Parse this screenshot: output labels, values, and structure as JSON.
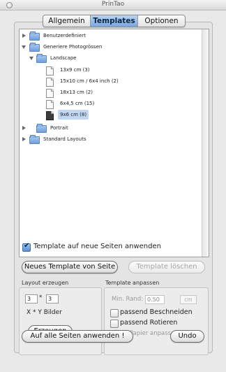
{
  "window": {
    "title": "PrinTao"
  },
  "tabs": [
    {
      "label": "Allgemein",
      "active": false
    },
    {
      "label": "Templates",
      "active": true
    },
    {
      "label": "Optionen",
      "active": false
    }
  ],
  "tree": {
    "items": [
      {
        "label": "Benutzerdefiniert",
        "type": "folder",
        "expanded": false
      },
      {
        "label": "Generiere Photogrössen",
        "type": "folder",
        "expanded": true
      },
      {
        "label": "Landscape",
        "type": "folder",
        "expanded": true
      },
      {
        "label": "13x9 cm (3)",
        "type": "template"
      },
      {
        "label": "15x10 cm / 6x4 inch (2)",
        "type": "template"
      },
      {
        "label": "18x13 cm (2)",
        "type": "template"
      },
      {
        "label": "6x4,5 cm (15)",
        "type": "template"
      },
      {
        "label": "9x6 cm (8)",
        "type": "template",
        "selected": true
      },
      {
        "label": "Portrait",
        "type": "folder",
        "expanded": false
      },
      {
        "label": "Standard Layouts",
        "type": "folder",
        "expanded": false
      }
    ]
  },
  "apply_new_pages": {
    "label": "Template auf neue Seiten anwenden",
    "checked": true
  },
  "buttons": {
    "new_template": "Neues Template von Seite",
    "delete_template": "Template löschen",
    "create": "Erzeugen",
    "apply_all": "Auf alle Seiten anwenden !",
    "undo": "Undo"
  },
  "layout_group": {
    "title": "Layout erzeugen",
    "x_value": "3",
    "y_value": "3",
    "multiply": "*",
    "caption": "X * Y Bilder"
  },
  "template_group": {
    "title": "Template anpassen",
    "min_rand_label": "Min. Rand:",
    "min_rand_value": "0.50",
    "unit": "cm",
    "fit_crop": {
      "label": "passend Beschneiden",
      "checked": false
    },
    "fit_rotate": {
      "label": "passend Rotieren",
      "checked": false
    },
    "fit_paper": {
      "label": "An Papier anpassen",
      "checked": true,
      "disabled": true
    }
  },
  "colors": {
    "accent": "#7aa7df",
    "selection": "#c2d7f3"
  }
}
